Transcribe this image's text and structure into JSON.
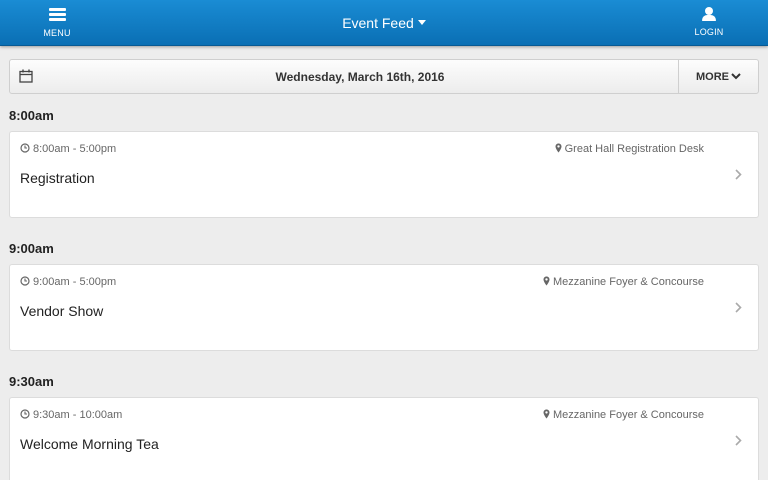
{
  "header": {
    "menu_label": "MENU",
    "title": "Event Feed",
    "login_label": "LOGIN"
  },
  "datebar": {
    "date": "Wednesday, March 16th, 2016",
    "more_label": "MORE"
  },
  "sections": [
    {
      "time": "8:00am",
      "event": {
        "time_range": "8:00am - 5:00pm",
        "location": "Great Hall Registration Desk",
        "title": "Registration"
      }
    },
    {
      "time": "9:00am",
      "event": {
        "time_range": "9:00am - 5:00pm",
        "location": "Mezzanine Foyer & Concourse",
        "title": "Vendor Show"
      }
    },
    {
      "time": "9:30am",
      "event": {
        "time_range": "9:30am - 10:00am",
        "location": "Mezzanine Foyer & Concourse",
        "title": "Welcome Morning Tea"
      }
    }
  ],
  "icons": {
    "menu": "hamburger-icon",
    "login": "user-icon",
    "calendar": "calendar-icon",
    "more": "chevron-down-icon",
    "time": "clock-icon",
    "location": "map-pin-icon",
    "row": "chevron-right-icon"
  },
  "colors": {
    "header_blue": "#0a6fb4",
    "background": "#ededed",
    "card": "#ffffff"
  }
}
